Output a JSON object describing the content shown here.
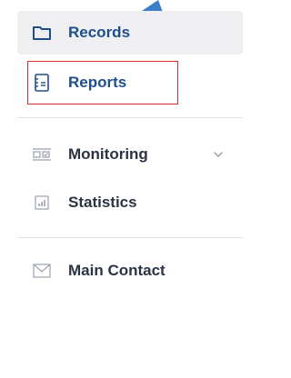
{
  "sidebar": {
    "items": [
      {
        "label": "Records",
        "icon": "folder-icon"
      },
      {
        "label": "Reports",
        "icon": "report-list-icon"
      },
      {
        "label": "Monitoring",
        "icon": "monitoring-icon"
      },
      {
        "label": "Statistics",
        "icon": "bar-chart-icon"
      },
      {
        "label": "Main Contact",
        "icon": "envelope-icon"
      }
    ]
  },
  "colors": {
    "accent": "#1f4f8a",
    "highlight_border": "#e22a2a",
    "active_bg": "#efeff2",
    "text": "#2a3445",
    "icon_muted": "#9aa1ad",
    "pointer": "#3b7fc9"
  }
}
